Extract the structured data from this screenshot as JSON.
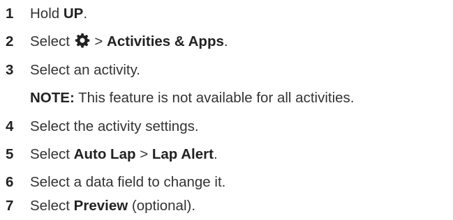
{
  "steps": [
    {
      "num": "1",
      "pre": "Hold ",
      "bold1": "UP",
      "mid": ".",
      "bold2": "",
      "post": ""
    },
    {
      "num": "2",
      "pre": "Select ",
      "icon": "gear-icon",
      "sep": " > ",
      "bold1": "Activities & Apps",
      "post": "."
    },
    {
      "num": "3",
      "pre": "Select an activity.",
      "bold1": "",
      "post": ""
    },
    {
      "num": "4",
      "pre": "Select the activity settings.",
      "bold1": "",
      "post": ""
    },
    {
      "num": "5",
      "pre": "Select ",
      "bold1": "Auto Lap",
      "mid": " > ",
      "bold2": "Lap Alert",
      "post": "."
    },
    {
      "num": "6",
      "pre": "Select a data field to change it.",
      "bold1": "",
      "post": ""
    },
    {
      "num": "7",
      "pre": "Select ",
      "bold1": "Preview",
      "mid": " (optional).",
      "bold2": "",
      "post": ""
    }
  ],
  "note": {
    "label": "NOTE:",
    "text": " This feature is not available for all activities."
  }
}
